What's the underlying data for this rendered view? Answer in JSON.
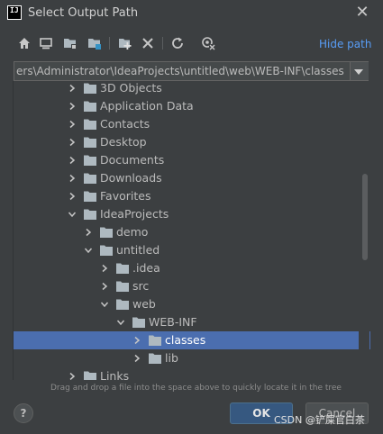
{
  "window": {
    "title": "Select Output Path",
    "close_glyph": "✕"
  },
  "toolbar": {
    "icons": [
      "home-icon",
      "desktop-icon",
      "project-folder-icon",
      "module-folder-icon",
      "new-folder-icon",
      "delete-icon",
      "refresh-icon",
      "show-hidden-icon"
    ],
    "hide_path_label": "Hide path"
  },
  "path_field": {
    "value": "ers\\Administrator\\IdeaProjects\\untitled\\web\\WEB-INF\\classes"
  },
  "tree": {
    "items": [
      {
        "label": "3D Objects",
        "expanded": false
      },
      {
        "label": "Application Data",
        "expanded": false
      },
      {
        "label": "Contacts",
        "expanded": false
      },
      {
        "label": "Desktop",
        "expanded": false
      },
      {
        "label": "Documents",
        "expanded": false
      },
      {
        "label": "Downloads",
        "expanded": false
      },
      {
        "label": "Favorites",
        "expanded": false
      },
      {
        "label": "IdeaProjects",
        "expanded": true
      },
      {
        "label": "demo",
        "expanded": false
      },
      {
        "label": "untitled",
        "expanded": true
      },
      {
        "label": ".idea",
        "expanded": false
      },
      {
        "label": "src",
        "expanded": false
      },
      {
        "label": "web",
        "expanded": true
      },
      {
        "label": "WEB-INF",
        "expanded": true
      },
      {
        "label": "classes",
        "expanded": false,
        "selected": true
      },
      {
        "label": "lib",
        "expanded": false
      },
      {
        "label": "Links",
        "expanded": false
      }
    ]
  },
  "hint": "Drag and drop a file into the space above to quickly locate it in the tree",
  "buttons": {
    "help": "?",
    "ok": "OK",
    "cancel": "Cancel"
  },
  "watermark": "CSDN @铲屎官白茶",
  "colors": {
    "selection": "#4b6eaf",
    "folder": "#aeb9c0",
    "link": "#589df6",
    "ok_button": "#365880"
  }
}
